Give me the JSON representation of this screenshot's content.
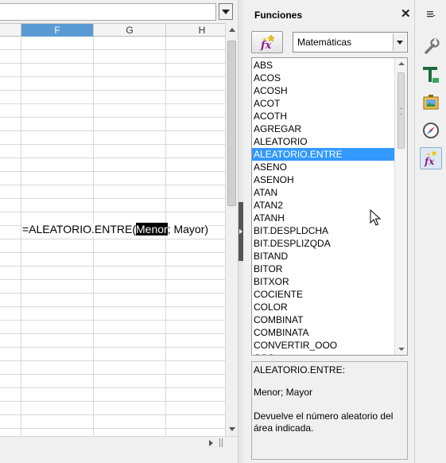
{
  "spreadsheet": {
    "columns": [
      "F",
      "G",
      "H"
    ],
    "active_column": "F",
    "cell_formula": {
      "prefix": "=ALEATORIO.ENTRE(",
      "highlight": "Menor",
      "suffix": "; Mayor)"
    }
  },
  "sidebar": {
    "title": "Funciones",
    "close_label": "✕",
    "insert_button_icon": "insert-function-icon",
    "category": "Matemáticas",
    "functions": [
      "ABS",
      "ACOS",
      "ACOSH",
      "ACOT",
      "ACOTH",
      "AGREGAR",
      "ALEATORIO",
      "ALEATORIO.ENTRE",
      "ASENO",
      "ASENOH",
      "ATAN",
      "ATAN2",
      "ATANH",
      "BIT.DESPLDCHA",
      "BIT.DESPLIZQDA",
      "BITAND",
      "BITOR",
      "BITXOR",
      "COCIENTE",
      "COLOR",
      "COMBINAT",
      "COMBINATA",
      "CONVERTIR_OOO",
      "COS"
    ],
    "selected_function": "ALEATORIO.ENTRE",
    "description": {
      "name": "ALEATORIO.ENTRE:",
      "args": "Menor; Mayor",
      "text": "Devuelve el número aleatorio del área indicada."
    }
  },
  "deck": {
    "buttons": [
      "properties-icon",
      "styles-icon",
      "gallery-icon",
      "navigator-icon",
      "functions-icon"
    ],
    "active": "functions-icon"
  },
  "colors": {
    "active_column": "#5b9bd5",
    "selection": "#3399ff",
    "fx_purple": "#8a1f8a"
  }
}
